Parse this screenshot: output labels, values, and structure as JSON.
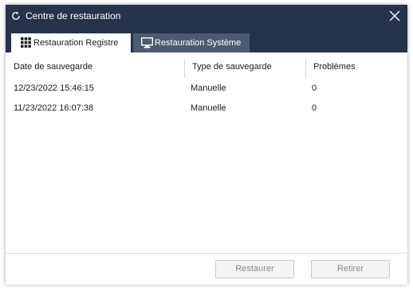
{
  "window": {
    "title": "Centre de restauration",
    "icon": "refresh-icon",
    "titlebar_color": "#26334a"
  },
  "tabs": [
    {
      "label": "Restauration Registre",
      "icon": "grid-icon",
      "active": true
    },
    {
      "label": "Restauration Système",
      "icon": "monitor-icon",
      "active": false
    }
  ],
  "table": {
    "columns": [
      "Date de sauvegarde",
      "Type de sauvegarde",
      "Problèmes"
    ],
    "rows": [
      {
        "date": "12/23/2022 15:46:15",
        "type": "Manuelle",
        "problems": "0"
      },
      {
        "date": "11/23/2022 16:07:38",
        "type": "Manuelle",
        "problems": "0"
      }
    ]
  },
  "footer": {
    "restore_label": "Restaurer",
    "remove_label": "Retirer"
  }
}
